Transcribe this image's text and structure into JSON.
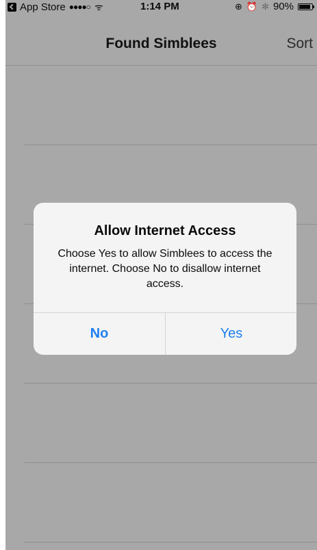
{
  "status_bar": {
    "back_app": "App Store",
    "signal": "●●●●○",
    "wifi": "ᯤ",
    "time": "1:14 PM",
    "lock_rotation": "⊕",
    "alarm": "⏰",
    "bluetooth": "✻",
    "battery_text": "90%",
    "battery_level": 0.9
  },
  "nav": {
    "title": "Found Simblees",
    "sort_label": "Sort"
  },
  "alert": {
    "title": "Allow Internet Access",
    "message": "Choose Yes to allow Simblees to access the internet. Choose No to disallow internet access.",
    "no_label": "No",
    "yes_label": "Yes"
  },
  "colors": {
    "overlay_bg": "#a8a8a8",
    "alert_bg": "#f4f4f4",
    "ios_blue": "#1e7ff0"
  }
}
